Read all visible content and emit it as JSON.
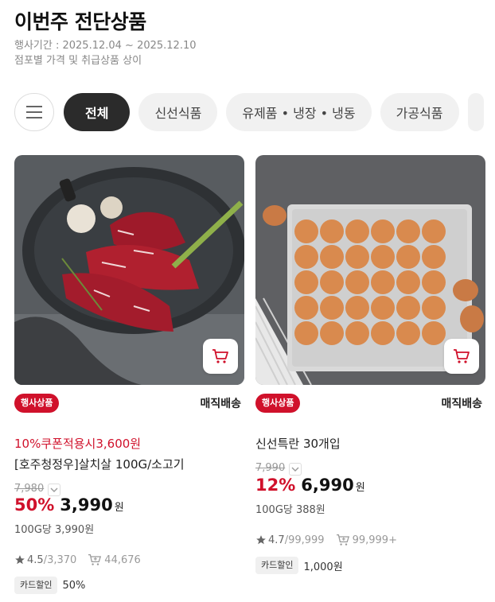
{
  "header": {
    "title": "이번주 전단상품",
    "period": "행사기간 : 2025.12.04 ~ 2025.12.10",
    "notice": "점포별 가격 및 취급상품 상이"
  },
  "categories": [
    "전체",
    "신선식품",
    "유제품 • 냉장 • 냉동",
    "가공식품"
  ],
  "products": [
    {
      "badge": "행사상품",
      "delivery": "매직배송",
      "coupon": "10%쿠폰적용시3,600원",
      "name": "[호주청정우]살치살 100G/소고기",
      "original_price": "7,980",
      "discount_rate": "50%",
      "price": "3,990",
      "currency": "원",
      "unit_price": "100G당 3,990원",
      "rating": "4.5",
      "review_count": "3,370",
      "cart_count": "44,676",
      "card_label": "카드할인",
      "card_value": "50%"
    },
    {
      "badge": "행사상품",
      "delivery": "매직배송",
      "name": "신선특란 30개입",
      "original_price": "7,990",
      "discount_rate": "12%",
      "price": "6,990",
      "currency": "원",
      "unit_price": "100G당 388원",
      "rating": "4.7",
      "review_count": "99,999",
      "cart_count": "99,999+",
      "card_label": "카드할인",
      "card_value": "1,000원"
    }
  ],
  "colors": {
    "accent": "#d0112b",
    "active_chip": "#2b2b2b",
    "chip_bg": "#f1f1f1"
  },
  "icons": [
    "menu-icon",
    "cart-icon",
    "star-icon",
    "cart-count-icon",
    "chevron-down-icon"
  ]
}
